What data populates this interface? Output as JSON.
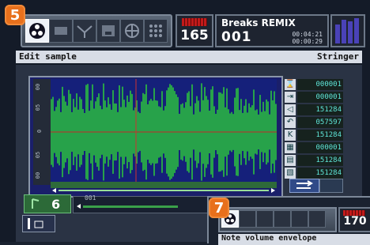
{
  "badges": {
    "main": "5",
    "second": "7"
  },
  "transport": {
    "bpm": "165",
    "song_title": "Breaks REMIX",
    "pattern": "001",
    "time_elapsed": "00:04:21",
    "time_total": "00:00:29"
  },
  "toolbar": {
    "tools": [
      {
        "icon": "disc-icon"
      },
      {
        "icon": "sample-icon"
      },
      {
        "icon": "envelope-icon"
      },
      {
        "icon": "save-icon"
      },
      {
        "icon": "wheel-icon"
      },
      {
        "icon": "grid-icon"
      }
    ]
  },
  "header": {
    "mode": "Edit sample",
    "effect": "Stringer"
  },
  "waveform": {
    "gutter_labels": [
      "00",
      "05",
      "0",
      "05",
      "00"
    ]
  },
  "counters": [
    {
      "icon": "x-icon",
      "value": "000001"
    },
    {
      "icon": "step-icon",
      "value": "000001"
    },
    {
      "icon": "speaker-icon",
      "value": "151284"
    },
    {
      "icon": "loop-back-icon",
      "value": "057597"
    },
    {
      "icon": "k-icon",
      "value": "151284"
    },
    {
      "icon": "start-icon",
      "value": "000001"
    },
    {
      "icon": "end-icon",
      "value": "151284"
    },
    {
      "icon": "pattern-icon",
      "value": "151284"
    }
  ],
  "track": {
    "number": "6",
    "mini_label": "001"
  },
  "second_screen": {
    "bpm": "170",
    "header": "Note volume envelope"
  },
  "colors": {
    "accent": "#e8701c",
    "wave_green": "#27a24a",
    "wave_blue": "#2a38a8",
    "counter_text": "#5fe6d8"
  }
}
